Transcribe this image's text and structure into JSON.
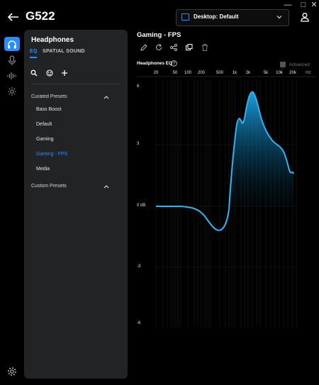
{
  "window": {
    "minimize": "—",
    "maximize": "□",
    "close": "✕"
  },
  "app": {
    "title": "G522"
  },
  "profile": {
    "label": "Desktop: Default"
  },
  "panel": {
    "title": "Headphones",
    "tabs": {
      "eq": "EQ",
      "spatial": "SPATIAL SOUND"
    },
    "curated_label": "Curated Presets",
    "presets": [
      "Bass Boost",
      "Default",
      "Gaming",
      "Gaming - FPS",
      "Media"
    ],
    "custom_label": "Custom Presets"
  },
  "eq": {
    "title": "Gaming - FPS",
    "label": "Headphones EQ",
    "advanced_label": "Advanced",
    "freq_labels": [
      "20",
      "50",
      "100",
      "200",
      "500",
      "1k",
      "2k",
      "5k",
      "10k",
      "20k"
    ],
    "hz_label": "Hz",
    "db_labels": [
      "6",
      "3",
      "0 dB",
      "-3",
      "-6"
    ]
  },
  "colors": {
    "accent": "#2b8cff",
    "panel": "#222325",
    "background": "#000000"
  }
}
